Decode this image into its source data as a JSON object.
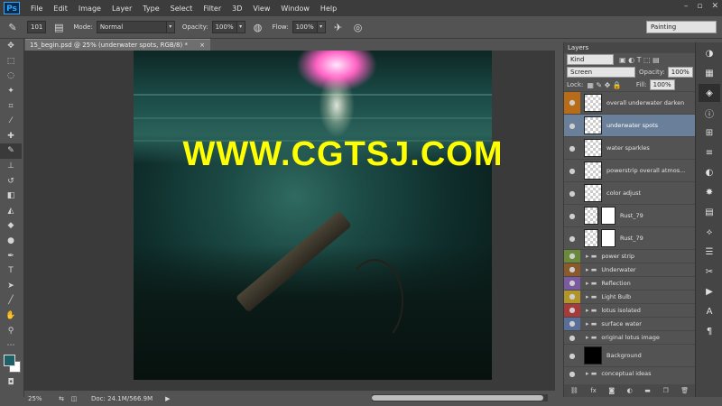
{
  "app": {
    "logo": "Ps",
    "menus": [
      "File",
      "Edit",
      "Image",
      "Layer",
      "Type",
      "Select",
      "Filter",
      "3D",
      "View",
      "Window",
      "Help"
    ],
    "window_controls": [
      "–",
      "▫",
      "✕"
    ]
  },
  "options": {
    "brush_size": "101",
    "mode_label": "Mode:",
    "mode_value": "Normal",
    "opacity_label": "Opacity:",
    "opacity_value": "100%",
    "flow_label": "Flow:",
    "flow_value": "100%",
    "workspace": "Painting"
  },
  "document": {
    "tab_title": "15_begin.psd @ 25% (underwater spots, RGB/8) *",
    "close": "×"
  },
  "watermark": "WWW.CGTSJ.COM",
  "status": {
    "zoom": "25%",
    "doc": "Doc: 24.1M/566.9M",
    "arrow": "▶"
  },
  "layers_panel": {
    "tab": "Layers",
    "filter_label": "Kind",
    "blend_mode": "Screen",
    "opacity_label": "Opacity:",
    "opacity_value": "100%",
    "lock_label": "Lock:",
    "fill_label": "Fill:",
    "fill_value": "100%",
    "layers": [
      {
        "name": "overall underwater darken",
        "color": "#b86c18",
        "type": "layer"
      },
      {
        "name": "underwater spots",
        "color": "",
        "type": "layer",
        "selected": true
      },
      {
        "name": "water sparkles",
        "color": "",
        "type": "layer"
      },
      {
        "name": "powerstrip overall atmos...",
        "color": "",
        "type": "layer"
      },
      {
        "name": "color adjust",
        "color": "",
        "type": "layer"
      },
      {
        "name": "Rust_79",
        "color": "",
        "type": "masked"
      },
      {
        "name": "Rust_79",
        "color": "",
        "type": "masked"
      }
    ],
    "groups": [
      {
        "name": "power strip",
        "color": "#6a8a3a"
      },
      {
        "name": "Underwater",
        "color": "#8a5a2a"
      },
      {
        "name": "Reflection",
        "color": "#7a5aa0"
      },
      {
        "name": "Light Bulb",
        "color": "#b0962a"
      },
      {
        "name": "lotus isolated",
        "color": "#a83a3a"
      },
      {
        "name": "surface water",
        "color": "#5a6e9a"
      },
      {
        "name": "original lotus image",
        "color": ""
      },
      {
        "name": "Background",
        "color": "",
        "type": "background"
      },
      {
        "name": "conceptual ideas",
        "color": ""
      }
    ],
    "footer_icons": [
      "link-icon",
      "fx-icon",
      "mask-icon",
      "adjustment-icon",
      "folder-icon",
      "new-layer-icon",
      "trash-icon"
    ]
  }
}
